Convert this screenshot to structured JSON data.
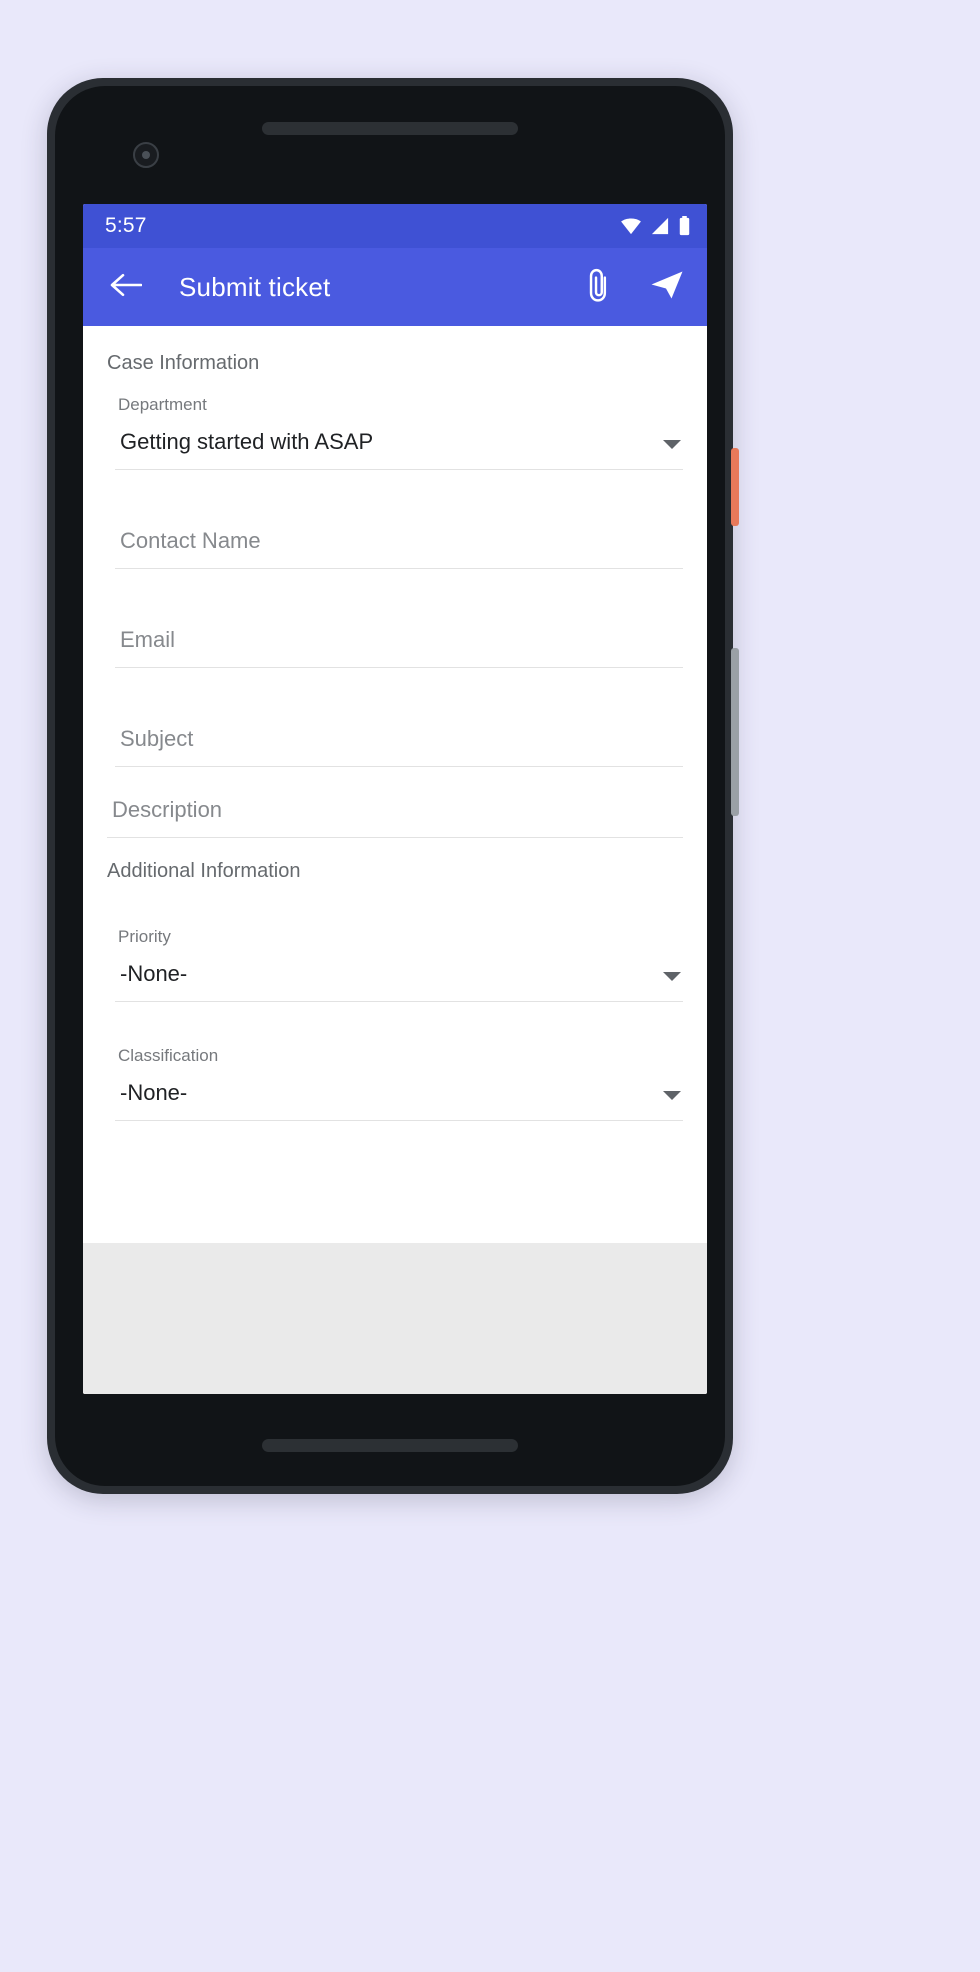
{
  "status_bar": {
    "time": "5:57",
    "icons": [
      "wifi-icon",
      "cellular-signal-icon",
      "battery-icon"
    ]
  },
  "app_bar": {
    "back_icon": "back-arrow-icon",
    "title": "Submit ticket",
    "attach_icon": "paperclip-icon",
    "send_icon": "send-icon"
  },
  "form": {
    "case_section_title": "Case Information",
    "additional_section_title": "Additional Information",
    "department": {
      "label": "Department",
      "value": "Getting started with ASAP"
    },
    "contact_name": {
      "placeholder": "Contact Name",
      "value": ""
    },
    "email": {
      "placeholder": "Email",
      "value": ""
    },
    "subject": {
      "placeholder": "Subject",
      "value": ""
    },
    "description": {
      "placeholder": "Description",
      "value": ""
    },
    "priority": {
      "label": "Priority",
      "value": "-None-"
    },
    "classification": {
      "label": "Classification",
      "value": "-None-"
    }
  },
  "colors": {
    "status_bar": "#3f51d4",
    "app_bar": "#4a5ae0",
    "page_background": "#e9e8fa",
    "content_background": "#ffffff"
  }
}
